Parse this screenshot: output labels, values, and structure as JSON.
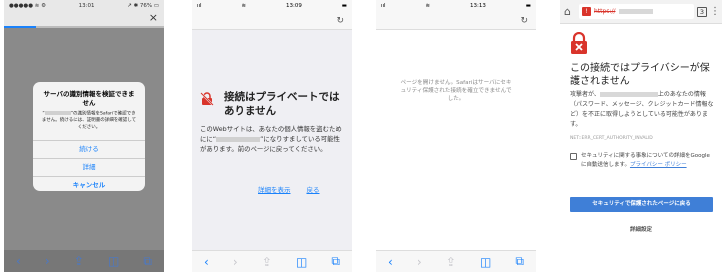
{
  "phone1": {
    "status": {
      "carrier": "●●●●● ≋ ⚙",
      "time": "13:01",
      "battery": "↗ ✱ 76% ▭"
    },
    "close_glyph": "×",
    "alert": {
      "title": "サーバの識別情報を検証できません",
      "message_prefix": "“",
      "message_suffix": "”の識別情報をSafariで確認できません。続けるには、証明書の詳細を確認してください。",
      "buttons": [
        "続ける",
        "詳細",
        "キャンセル"
      ]
    },
    "toolbar": [
      "‹",
      "›",
      "⇪",
      "◫",
      "⧉"
    ]
  },
  "phone2": {
    "status": {
      "signal": "ııl",
      "wifi": "≋",
      "time": "13:09",
      "battery": "▬"
    },
    "reload_glyph": "↻",
    "title": "接続はプライベートではありません",
    "body_1": "このWebサイトは、あなたの個人情報を盗むためにそのWebサイトになりすましている可能性があります。前のページに戻ってください。",
    "body_prefix": "に“",
    "body_suffix": "”になりすましている可能性があります。前のページに戻ってください。",
    "lead": "このWebサイトは、あなたの個人情報を盗むために",
    "links": {
      "details": "詳細を表示",
      "back": "戻る"
    },
    "toolbar": [
      "‹",
      "›",
      "⇪",
      "◫",
      "⧉"
    ]
  },
  "phone3": {
    "status": {
      "signal": "ııl",
      "wifi": "≋",
      "time": "13:13",
      "battery": "▬"
    },
    "reload_glyph": "↻",
    "message": "ページを開けません。Safariはサーバにセキュリティ保護された接続を確立できませんでした。",
    "toolbar": [
      "‹",
      "›",
      "⇪",
      "◫",
      "⧉"
    ]
  },
  "phone4": {
    "home_glyph": "⌂",
    "url_prefix": "https://",
    "tab_count": "3",
    "menu_glyph": "⋮",
    "title": "この接続ではプライバシーが保護されません",
    "body_a": "攻撃者が、",
    "body_b": "上のあなたの情報（パスワード、メッセージ、クレジットカード情報など）を不正に取得しようとしている可能性があります。",
    "error_code": "NET::ERR_CERT_AUTHORITY_INVALID",
    "checkbox_label": "セキュリティに関する事象についての詳細をGoogle に自動送信します。",
    "policy_link": "プライバシー ポリシー",
    "back_button": "セキュリティで保護されたページに戻る",
    "advanced": "詳細設定",
    "colors": {
      "accent": "#3f7fd7",
      "danger": "#d9342b"
    }
  }
}
